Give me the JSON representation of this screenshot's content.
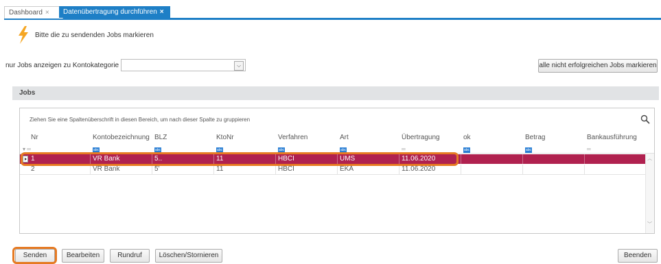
{
  "tabs": [
    {
      "label": "Dashboard",
      "close": "×"
    },
    {
      "label": "Datenübertragung durchführen",
      "close": "×"
    }
  ],
  "header": {
    "message": "Bitte die zu sendenden Jobs markieren",
    "icon": "lightning-bolt-icon",
    "icon_color": "#f5a623"
  },
  "filter": {
    "label": "nur Jobs anzeigen zu Kontokategorie",
    "value": ""
  },
  "mark_failed_button": "alle nicht erfolgreichen Jobs markieren",
  "jobs_section": {
    "title": "Jobs"
  },
  "grid": {
    "group_hint": "Ziehen Sie eine Spaltenüberschrift in diesen Bereich, um nach dieser Spalte zu gruppieren",
    "columns": [
      "Nr",
      "Kontobezeichnung",
      "BLZ",
      "KtoNr",
      "Verfahren",
      "Art",
      "Übertragung",
      "ok",
      "Betrag",
      "Bankausführung"
    ],
    "rows": [
      {
        "nr": "1",
        "konto": "VR Bank",
        "blz": "5..",
        "ktonr": "11",
        "verfahren": "HBCI",
        "art": "UMS",
        "uebertragung": "11.06.2020",
        "ok": "",
        "betrag": "",
        "bank": "",
        "selected": true
      },
      {
        "nr": "2",
        "konto": "VR Bank",
        "blz": "5'",
        "ktonr": "11",
        "verfahren": "HBCI",
        "art": "EKA",
        "uebertragung": "11.06.2020",
        "ok": "",
        "betrag": "",
        "bank": "",
        "selected": false
      }
    ],
    "selected_row_color": "#b0214f"
  },
  "footer": {
    "send": "Senden",
    "edit": "Bearbeiten",
    "poll": "Rundruf",
    "delete": "Löschen/Stornieren",
    "exit": "Beenden"
  },
  "accent_color": "#1e7fc6",
  "highlight_color": "#e67a22"
}
